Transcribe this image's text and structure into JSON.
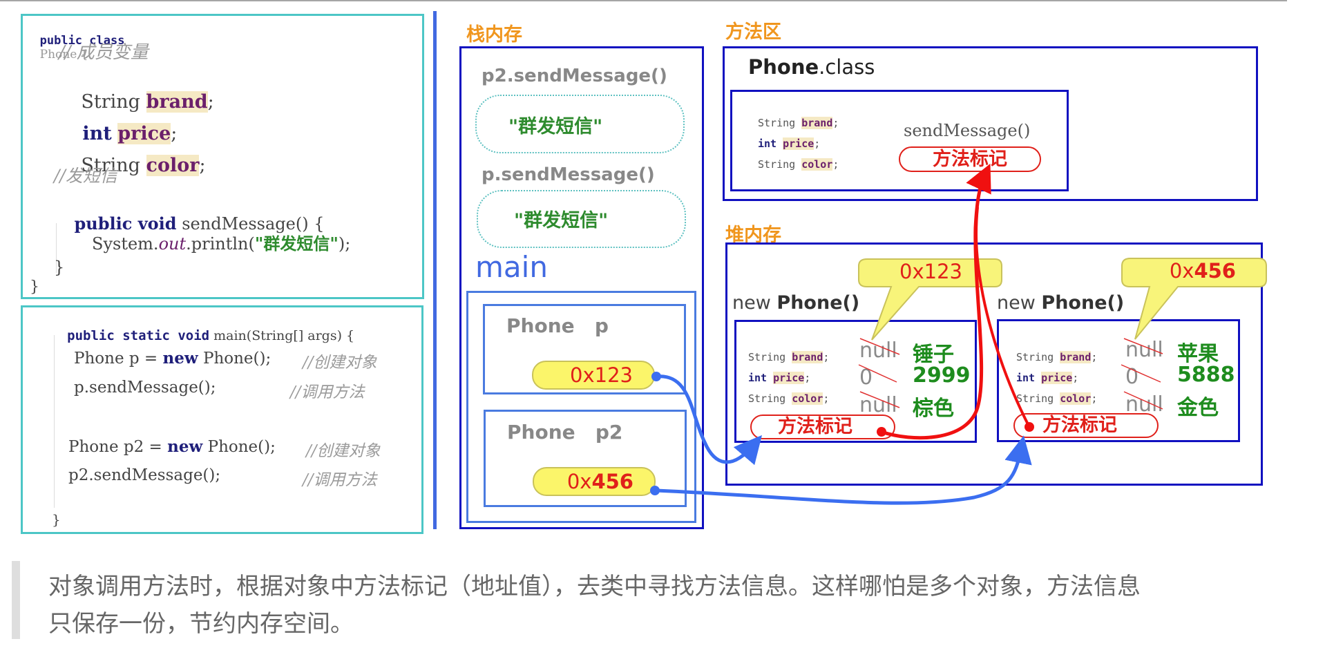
{
  "class_code": {
    "line1": {
      "kw": "public class",
      "name": "Phone {"
    },
    "comment_members": "// 成员变量",
    "fields": [
      {
        "type": "String",
        "name": "brand"
      },
      {
        "type": "int",
        "name": "price"
      },
      {
        "type": "String",
        "name": "color"
      }
    ],
    "comment_send": "//发短信",
    "method_sig": {
      "kw": "public void",
      "name": "sendMessage() {"
    },
    "println": {
      "prefix": "System.",
      "out": "out",
      "mid": ".println(",
      "str": "\"群发短信\"",
      "suffix": ");"
    },
    "close_method": "}",
    "close_class": "}"
  },
  "main_code": {
    "sig": {
      "kw": "public static void",
      "rest": "main(String[] args) {"
    },
    "lines": [
      {
        "pre": "Phone p = ",
        "kw": "new",
        "post": " Phone();",
        "comment": "//创建对象"
      },
      {
        "pre": "p.sendMessage();",
        "kw": "",
        "post": "",
        "comment": "//调用方法"
      },
      {
        "pre": "Phone p2 = ",
        "kw": "new",
        "post": " Phone();",
        "comment": "//创建对象"
      },
      {
        "pre": "p2.sendMessage();",
        "kw": "",
        "post": "",
        "comment": "//调用方法"
      }
    ],
    "close": "}"
  },
  "stack": {
    "label": "栈内存",
    "frames": [
      {
        "title": "p2.sendMessage()",
        "content": "\"群发短信\""
      },
      {
        "title": "p.sendMessage()",
        "content": "\"群发短信\""
      }
    ],
    "main_label": "main",
    "vars": [
      {
        "type": "Phone",
        "name": "p",
        "address": "0x123"
      },
      {
        "type": "Phone",
        "name": "p2",
        "address_prefix": "0x",
        "address_num": "456"
      }
    ]
  },
  "method_area": {
    "label": "方法区",
    "class_name": "Phone",
    "class_ext": ".class",
    "fields": [
      {
        "type": "String",
        "name": "brand"
      },
      {
        "type": "int",
        "name": "price"
      },
      {
        "type": "String",
        "name": "color"
      }
    ],
    "method_name": "sendMessage()",
    "method_marker": "方法标记"
  },
  "heap": {
    "label": "堆内存",
    "objects": [
      {
        "new_kw": "new",
        "class_call": "Phone()",
        "address": "0x123",
        "fields": [
          {
            "type": "String",
            "name": "brand",
            "default": "null",
            "value": "锤子"
          },
          {
            "type": "int",
            "name": "price",
            "default": "0",
            "value": "2999"
          },
          {
            "type": "String",
            "name": "color",
            "default": "null",
            "value": "棕色"
          }
        ],
        "method_marker": "方法标记"
      },
      {
        "new_kw": "new",
        "class_call": "Phone()",
        "address_prefix": "0x",
        "address_num": "456",
        "fields": [
          {
            "type": "String",
            "name": "brand",
            "default": "null",
            "value": "苹果"
          },
          {
            "type": "int",
            "name": "price",
            "default": "0",
            "value": "5888"
          },
          {
            "type": "String",
            "name": "color",
            "default": "null",
            "value": "金色"
          }
        ],
        "method_marker": "方法标记"
      }
    ]
  },
  "caption": {
    "line1": "对象调用方法时，根据对象中方法标记（地址值），去类中寻找方法信息。这样哪怕是多个对象，方法信息",
    "line2": "只保存一份，节约内存空间。"
  },
  "colors": {
    "section_label": "#f0961e",
    "box_navy": "#1010c0",
    "box_blue": "#4a7be0",
    "code_border": "#4cc6c6",
    "reference_arrow": "#3b6ef0",
    "method_arrow": "#f01010",
    "address_text": "#e0201a",
    "value_green": "#1e8c1e"
  }
}
